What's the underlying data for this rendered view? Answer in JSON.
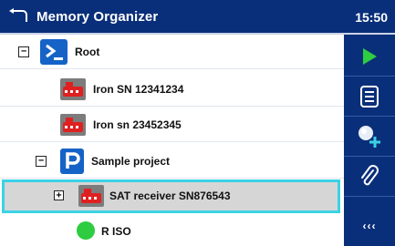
{
  "header": {
    "title": "Memory Organizer",
    "time": "15:50"
  },
  "tree": {
    "root": {
      "label": "Root",
      "expander": "−"
    },
    "objects": [
      {
        "label": "Iron SN 12341234"
      },
      {
        "label": "Iron sn 23452345"
      }
    ],
    "project": {
      "label": "Sample project",
      "expander": "−"
    },
    "selected_object": {
      "label": "SAT receiver SN876543",
      "expander": "+"
    },
    "measurement": {
      "label": "R ISO",
      "status_color": "#2ecc40"
    }
  },
  "side_panel": {
    "more_label": "‹‹‹"
  },
  "colors": {
    "header_bg": "#0a2f7a",
    "panel_bg": "#0a2f7a",
    "selection_outline": "#3bd2e6",
    "selection_bg": "#d6d6d6",
    "play_green": "#2ecc40"
  },
  "icons": [
    "back-arrow-icon",
    "root-terminal-icon",
    "object-red-device-icon",
    "project-p-icon",
    "status-dot-icon",
    "play-icon",
    "list-icon",
    "add-node-icon",
    "attach-clip-icon"
  ]
}
